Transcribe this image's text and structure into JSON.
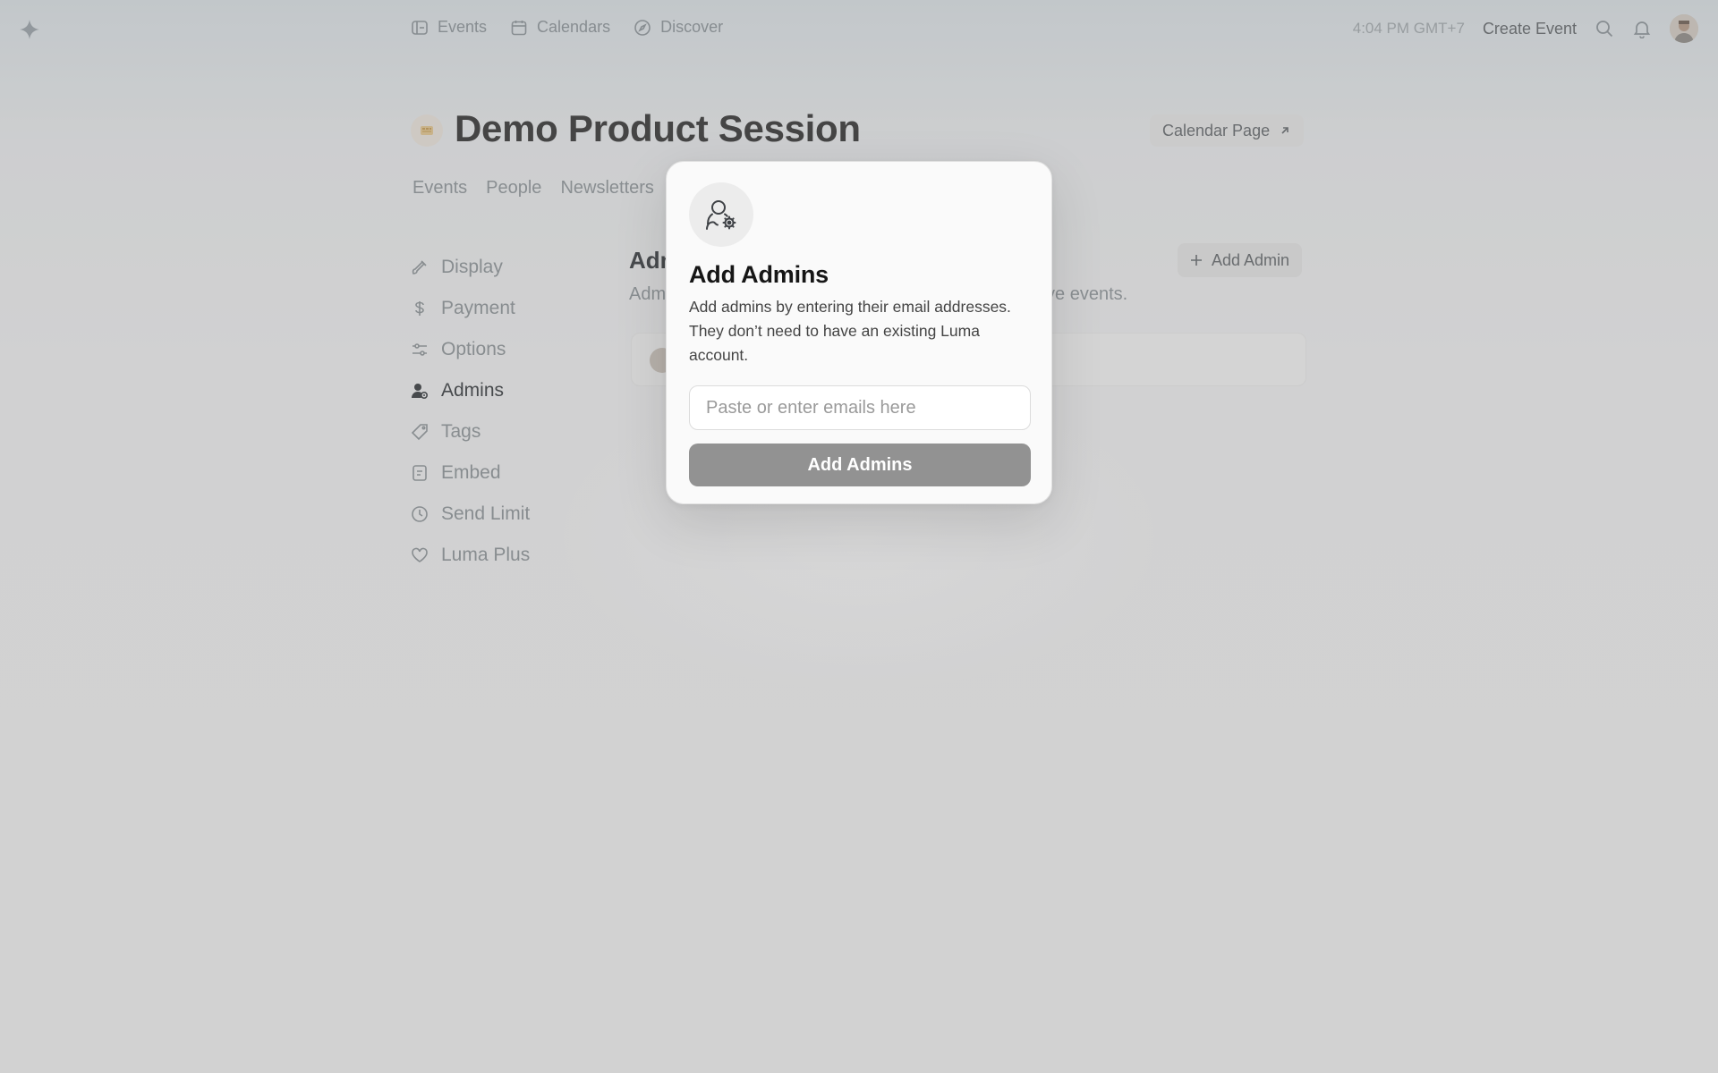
{
  "nav": {
    "logo_icon": "sparkle-icon",
    "links": [
      {
        "label": "Events",
        "icon": "ticket-icon"
      },
      {
        "label": "Calendars",
        "icon": "calendar-icon"
      },
      {
        "label": "Discover",
        "icon": "compass-icon"
      }
    ],
    "time": "4:04 PM GMT+7",
    "create_event": "Create Event"
  },
  "header": {
    "title": "Demo Product Session",
    "calendar_page": "Calendar Page"
  },
  "tabs": [
    "Events",
    "People",
    "Newsletters"
  ],
  "sidebar": {
    "active": "Admins",
    "items": [
      {
        "label": "Display",
        "icon": "brush-icon"
      },
      {
        "label": "Payment",
        "icon": "dollar-icon"
      },
      {
        "label": "Options",
        "icon": "sliders-icon"
      },
      {
        "label": "Admins",
        "icon": "user-gear-icon"
      },
      {
        "label": "Tags",
        "icon": "tag-icon"
      },
      {
        "label": "Embed",
        "icon": "embed-icon"
      },
      {
        "label": "Send Limit",
        "icon": "clock-icon"
      },
      {
        "label": "Luma Plus",
        "icon": "heart-icon"
      }
    ]
  },
  "main": {
    "section_title": "Adm",
    "section_desc_left": "Adm",
    "section_desc_right": "prove events.",
    "add_admin": "Add Admin"
  },
  "modal": {
    "title": "Add Admins",
    "description": "Add admins by entering their email addresses. They don’t need to have an existing Luma account.",
    "input_placeholder": "Paste or enter emails here",
    "input_value": "",
    "submit": "Add Admins"
  },
  "colors": {
    "accent_disabled": "#929292",
    "modal_bg": "#fafafa",
    "overlay": "rgba(130,130,130,0.30)"
  }
}
